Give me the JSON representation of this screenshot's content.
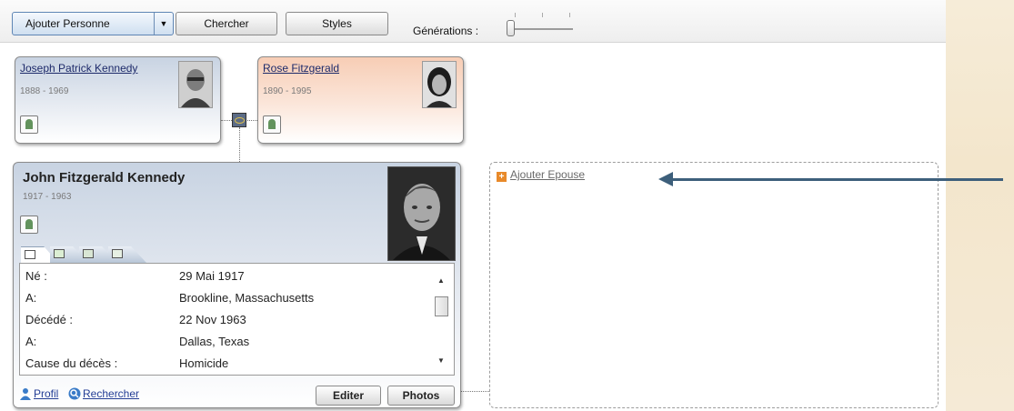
{
  "toolbar": {
    "add_person_label": "Ajouter Personne",
    "search_label": "Chercher",
    "styles_label": "Styles",
    "generations_label": "Générations :"
  },
  "father": {
    "name": "Joseph Patrick Kennedy",
    "dates": "1888 - 1969"
  },
  "mother": {
    "name": "Rose Fitzgerald",
    "dates": "1890 - 1995"
  },
  "person": {
    "name": "John Fitzgerald Kennedy",
    "dates": "1917 - 1963",
    "details": [
      {
        "label": "Né :",
        "value": "29 Mai 1917"
      },
      {
        "label": "A:",
        "value": "Brookline, Massachusetts"
      },
      {
        "label": "Décédé :",
        "value": "22 Nov 1963"
      },
      {
        "label": "A:",
        "value": "Dallas, Texas"
      },
      {
        "label": "Cause du décès :",
        "value": "Homicide"
      }
    ],
    "footer": {
      "profile_label": "Profil",
      "search_label": "Rechercher",
      "edit_label": "Editer",
      "photos_label": "Photos"
    }
  },
  "spouse": {
    "add_label": "Ajouter Epouse"
  },
  "colors": {
    "card_blue": "#c8d3e2",
    "card_pink": "#f7cdb5",
    "link": "#1d2a6a",
    "arrow": "#3d5f7b"
  }
}
